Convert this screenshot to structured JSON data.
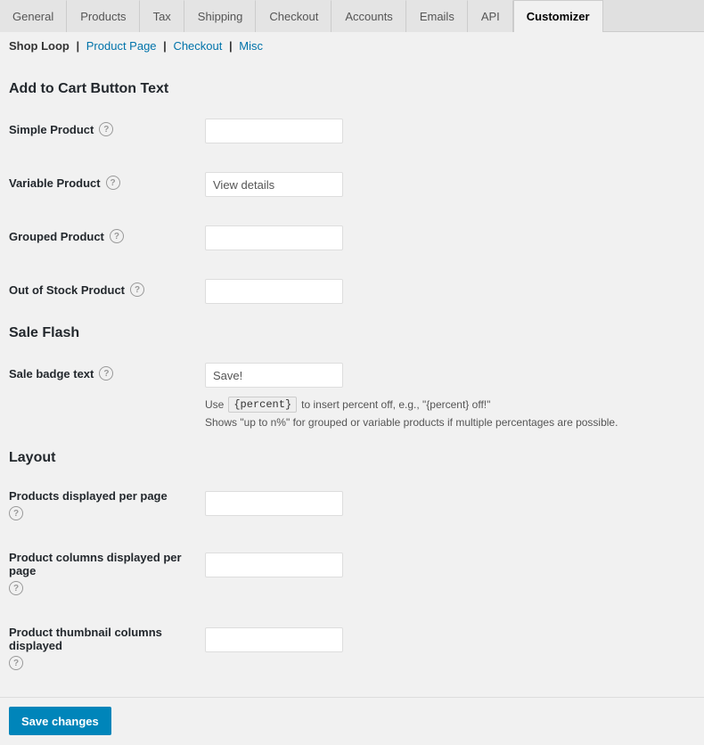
{
  "tabs": [
    {
      "id": "general",
      "label": "General",
      "active": false
    },
    {
      "id": "products",
      "label": "Products",
      "active": false
    },
    {
      "id": "tax",
      "label": "Tax",
      "active": false
    },
    {
      "id": "shipping",
      "label": "Shipping",
      "active": false
    },
    {
      "id": "checkout",
      "label": "Checkout",
      "active": false
    },
    {
      "id": "accounts",
      "label": "Accounts",
      "active": false
    },
    {
      "id": "emails",
      "label": "Emails",
      "active": false
    },
    {
      "id": "api",
      "label": "API",
      "active": false
    },
    {
      "id": "customizer",
      "label": "Customizer",
      "active": true
    }
  ],
  "breadcrumb": {
    "items": [
      {
        "id": "shop-loop",
        "label": "Shop Loop",
        "link": false
      },
      {
        "id": "product-page",
        "label": "Product Page",
        "link": true
      },
      {
        "id": "checkout",
        "label": "Checkout",
        "link": true
      },
      {
        "id": "misc",
        "label": "Misc",
        "link": true
      }
    ]
  },
  "sections": {
    "add_to_cart": {
      "heading": "Add to Cart Button Text",
      "fields": [
        {
          "id": "simple_product",
          "label": "Simple Product",
          "value": "",
          "placeholder": ""
        },
        {
          "id": "variable_product",
          "label": "Variable Product",
          "value": "View details",
          "placeholder": ""
        },
        {
          "id": "grouped_product",
          "label": "Grouped Product",
          "value": "",
          "placeholder": ""
        },
        {
          "id": "out_of_stock",
          "label": "Out of Stock Product",
          "value": "",
          "placeholder": ""
        }
      ]
    },
    "sale_flash": {
      "heading": "Sale Flash",
      "fields": [
        {
          "id": "sale_badge_text",
          "label": "Sale badge text",
          "value": "Save!",
          "placeholder": "",
          "hint_prefix": "Use",
          "hint_code": "{percent}",
          "hint_suffix": "to insert percent off, e.g., \"{percent} off!\"",
          "hint_line2": "Shows \"up to n%\" for grouped or variable products if multiple percentages are possible."
        }
      ]
    },
    "layout": {
      "heading": "Layout",
      "fields": [
        {
          "id": "products_per_page",
          "label": "Products displayed per page",
          "value": "",
          "placeholder": "",
          "multiline_label": true
        },
        {
          "id": "product_columns",
          "label": "Product columns displayed per page",
          "value": "",
          "placeholder": "",
          "multiline_label": true
        },
        {
          "id": "thumbnail_columns",
          "label": "Product thumbnail columns displayed",
          "value": "",
          "placeholder": "",
          "multiline_label": true
        }
      ]
    }
  },
  "buttons": {
    "save_changes": "Save changes"
  },
  "icons": {
    "help": "?"
  }
}
